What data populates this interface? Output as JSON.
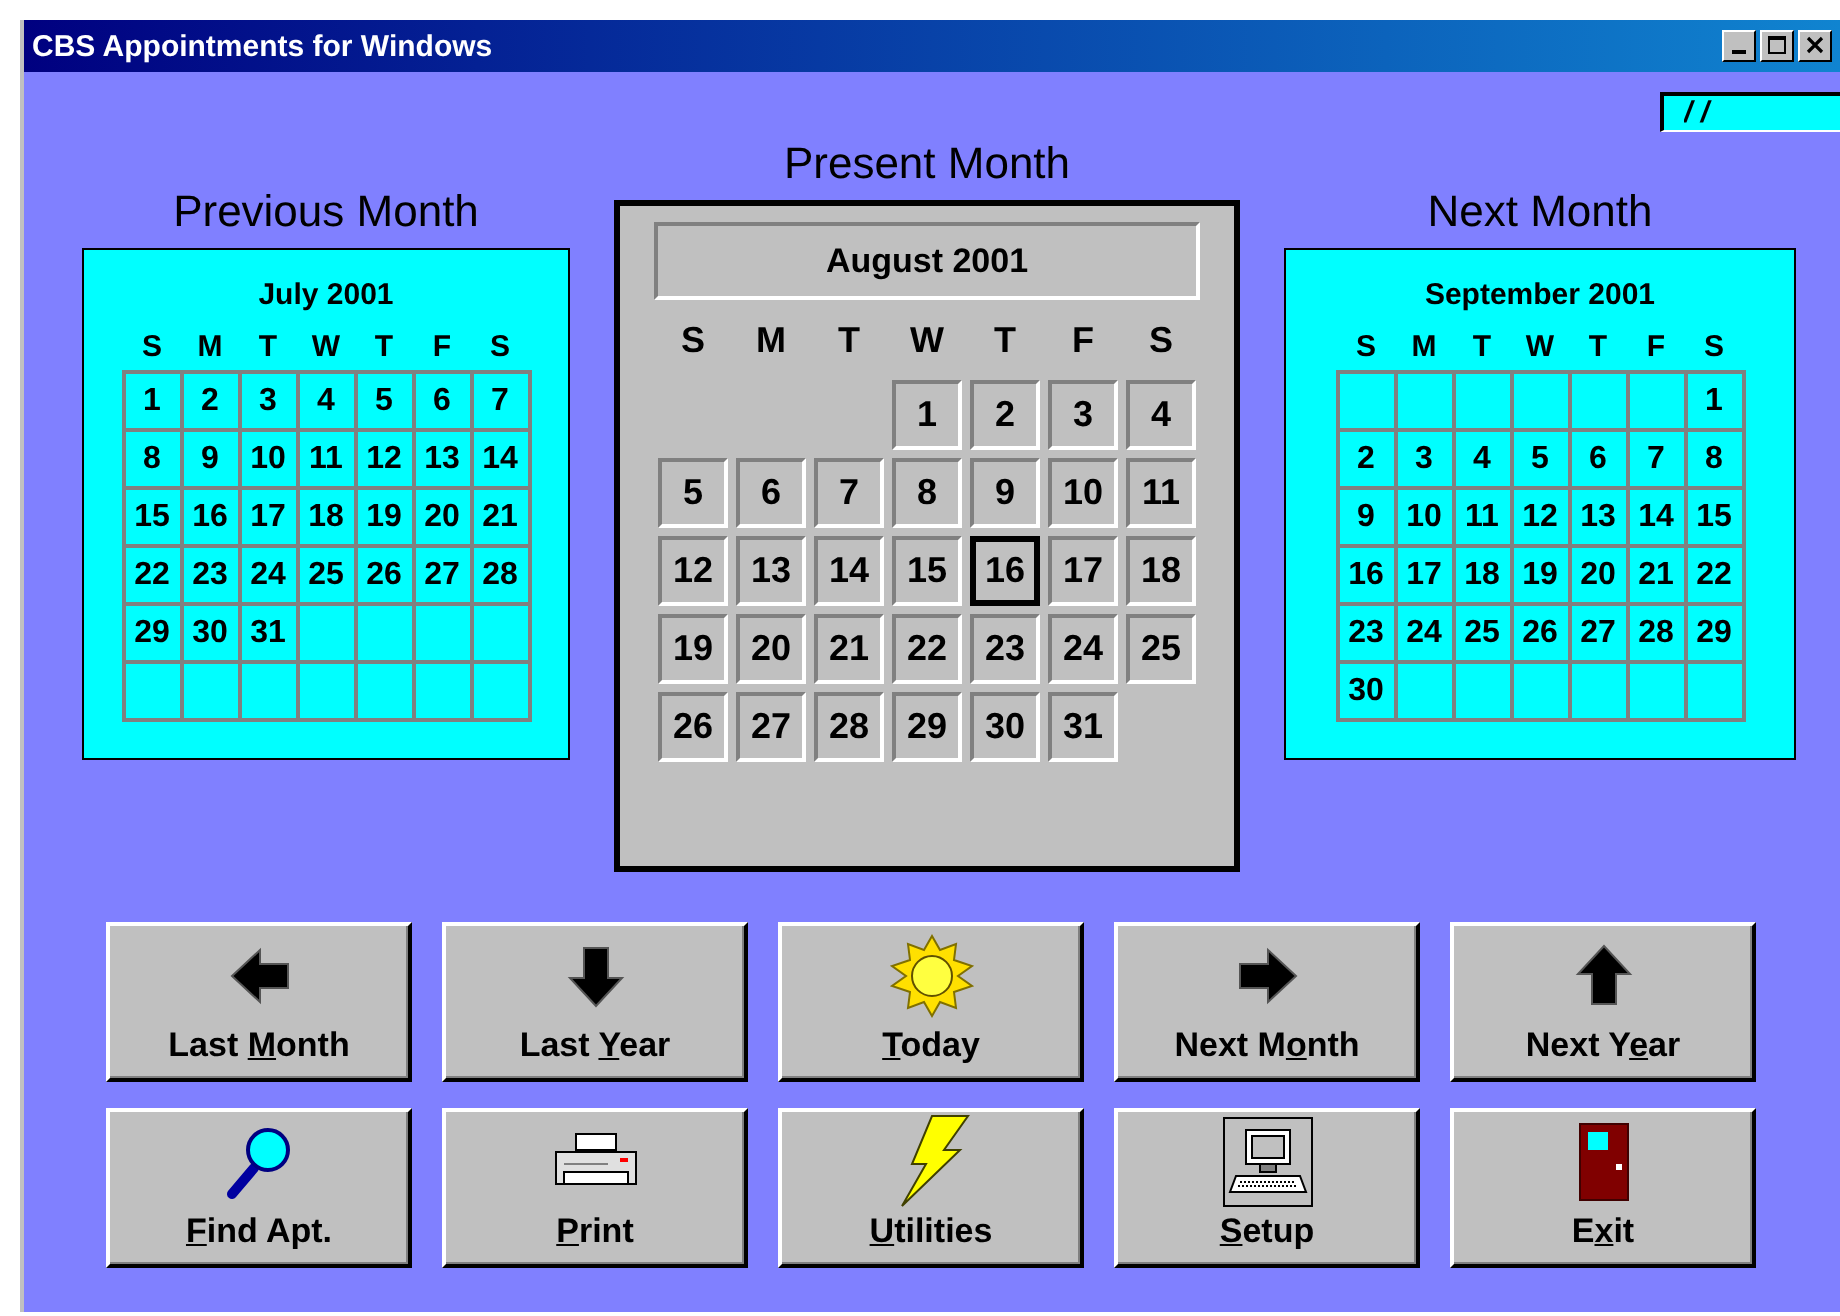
{
  "window": {
    "title": "CBS Appointments for Windows"
  },
  "date_field": {
    "value": "/ /"
  },
  "previous_month": {
    "heading": "Previous Month",
    "title": "July 2001",
    "weekdays": [
      "S",
      "M",
      "T",
      "W",
      "T",
      "F",
      "S"
    ],
    "weeks": [
      [
        "1",
        "2",
        "3",
        "4",
        "5",
        "6",
        "7"
      ],
      [
        "8",
        "9",
        "10",
        "11",
        "12",
        "13",
        "14"
      ],
      [
        "15",
        "16",
        "17",
        "18",
        "19",
        "20",
        "21"
      ],
      [
        "22",
        "23",
        "24",
        "25",
        "26",
        "27",
        "28"
      ],
      [
        "29",
        "30",
        "31"
      ]
    ]
  },
  "present_month": {
    "heading": "Present Month",
    "title": "August 2001",
    "weekdays": [
      "S",
      "M",
      "T",
      "W",
      "T",
      "F",
      "S"
    ],
    "weeks": [
      [
        {
          "day": "1",
          "selected": false
        },
        {
          "day": "2",
          "selected": false
        },
        {
          "day": "3",
          "selected": false
        },
        {
          "day": "4",
          "selected": false
        }
      ],
      [
        {
          "day": "5",
          "selected": false
        },
        {
          "day": "6",
          "selected": false
        },
        {
          "day": "7",
          "selected": false
        },
        {
          "day": "8",
          "selected": false
        },
        {
          "day": "9",
          "selected": false
        },
        {
          "day": "10",
          "selected": false
        },
        {
          "day": "11",
          "selected": false
        }
      ],
      [
        {
          "day": "12",
          "selected": false
        },
        {
          "day": "13",
          "selected": false
        },
        {
          "day": "14",
          "selected": false
        },
        {
          "day": "15",
          "selected": false
        },
        {
          "day": "16",
          "selected": true
        },
        {
          "day": "17",
          "selected": false
        },
        {
          "day": "18",
          "selected": false
        }
      ],
      [
        {
          "day": "19",
          "selected": false
        },
        {
          "day": "20",
          "selected": false
        },
        {
          "day": "21",
          "selected": false
        },
        {
          "day": "22",
          "selected": false
        },
        {
          "day": "23",
          "selected": false
        },
        {
          "day": "24",
          "selected": false
        },
        {
          "day": "25",
          "selected": false
        }
      ],
      [
        {
          "day": "26",
          "selected": false
        },
        {
          "day": "27",
          "selected": false
        },
        {
          "day": "28",
          "selected": false
        },
        {
          "day": "29",
          "selected": false
        },
        {
          "day": "30",
          "selected": false
        },
        {
          "day": "31",
          "selected": false
        }
      ]
    ]
  },
  "next_month": {
    "heading": "Next Month",
    "title": "September 2001",
    "weekdays": [
      "S",
      "M",
      "T",
      "W",
      "T",
      "F",
      "S"
    ],
    "weeks": [
      [
        "1"
      ],
      [
        "2",
        "3",
        "4",
        "5",
        "6",
        "7",
        "8"
      ],
      [
        "9",
        "10",
        "11",
        "12",
        "13",
        "14",
        "15"
      ],
      [
        "16",
        "17",
        "18",
        "19",
        "20",
        "21",
        "22"
      ],
      [
        "23",
        "24",
        "25",
        "26",
        "27",
        "28",
        "29"
      ],
      [
        "30"
      ]
    ]
  },
  "buttons": [
    {
      "kind": "left-arrow",
      "label": {
        "before": "Last ",
        "access_key": "M",
        "after": "onth"
      }
    },
    {
      "kind": "down-arrow",
      "label": {
        "before": "Last ",
        "access_key": "Y",
        "after": "ear"
      }
    },
    {
      "kind": "sun",
      "label": {
        "access_key": "T",
        "after": "oday"
      }
    },
    {
      "kind": "right-arrow",
      "label": {
        "before": "Next M",
        "access_key": "o",
        "after": "nth"
      }
    },
    {
      "kind": "up-arrow",
      "label": {
        "before": "Next Y",
        "access_key": "e",
        "after": "ar"
      }
    },
    {
      "kind": "magnifier",
      "label": {
        "access_key": "F",
        "after": "ind Apt."
      }
    },
    {
      "kind": "printer",
      "label": {
        "access_key": "P",
        "after": "rint"
      }
    },
    {
      "kind": "lightning",
      "label": {
        "access_key": "U",
        "after": "tilities"
      }
    },
    {
      "kind": "computer",
      "label": {
        "access_key": "S",
        "after": "etup"
      }
    },
    {
      "kind": "door",
      "label": {
        "before": "E",
        "access_key": "x",
        "after": "it"
      }
    }
  ]
}
